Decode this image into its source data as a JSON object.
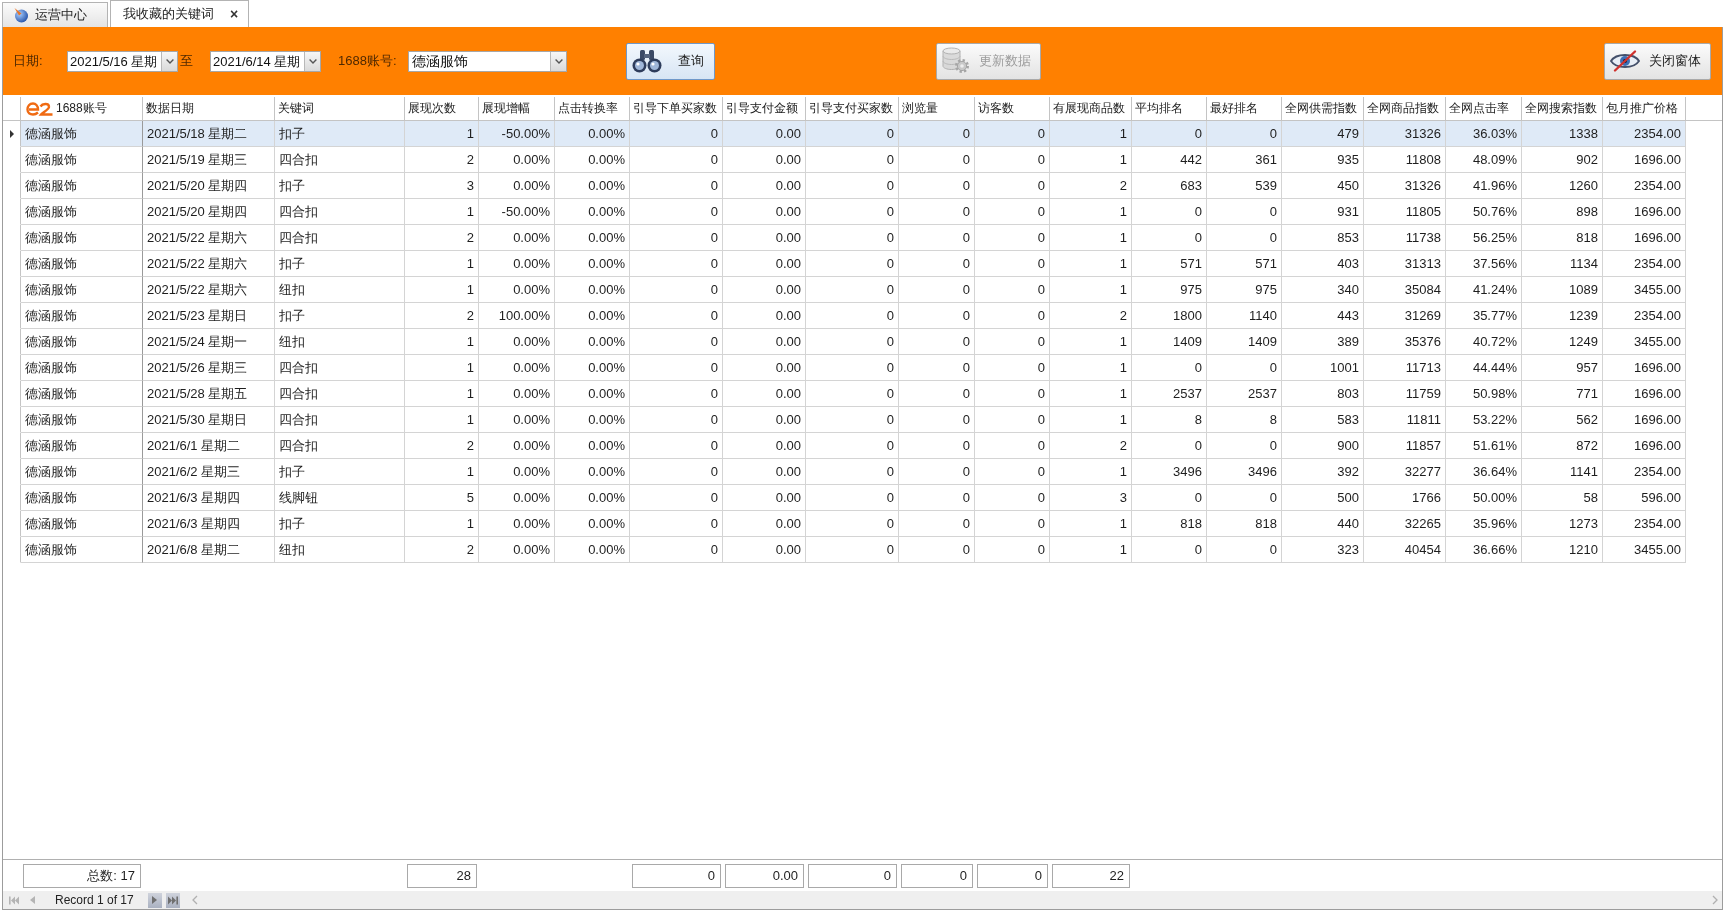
{
  "tabs": [
    {
      "label": "运营中心",
      "selected": false
    },
    {
      "label": "我收藏的关键词",
      "selected": true,
      "close": "×"
    }
  ],
  "toolbar": {
    "date_label": "日期:",
    "date_from": {
      "value": "2021/5/16 星期"
    },
    "date_separator": "至",
    "date_to": {
      "value": "2021/6/14 星期"
    },
    "account_label": "1688账号:",
    "account": {
      "value": "德涵服饰"
    },
    "buttons": [
      {
        "kind": "query",
        "label": "查询",
        "disabled": false,
        "focused": true
      },
      {
        "kind": "update",
        "label": "更新数据",
        "disabled": true,
        "focused": false
      },
      {
        "kind": "close",
        "label": "关闭窗体",
        "disabled": false,
        "focused": false
      }
    ]
  },
  "table": {
    "columns": [
      {
        "label": "1688账号",
        "kind": "text",
        "total": "总数: 17"
      },
      {
        "label": "数据日期",
        "kind": "text"
      },
      {
        "label": "关键词",
        "kind": "text"
      },
      {
        "label": "展现次数",
        "kind": "number",
        "total": "28"
      },
      {
        "label": "展现增幅",
        "kind": "number"
      },
      {
        "label": "点击转换率",
        "kind": "number"
      },
      {
        "label": "引导下单买家数",
        "kind": "number",
        "total": "0"
      },
      {
        "label": "引导支付金额",
        "kind": "number",
        "total": "0.00"
      },
      {
        "label": "引导支付买家数",
        "kind": "number",
        "total": "0"
      },
      {
        "label": "浏览量",
        "kind": "number",
        "total": "0"
      },
      {
        "label": "访客数",
        "kind": "number",
        "total": "0"
      },
      {
        "label": "有展现商品数",
        "kind": "number",
        "total": "22"
      },
      {
        "label": "平均排名",
        "kind": "number"
      },
      {
        "label": "最好排名",
        "kind": "number"
      },
      {
        "label": "全网供需指数",
        "kind": "number"
      },
      {
        "label": "全网商品指数",
        "kind": "number"
      },
      {
        "label": "全网点击率",
        "kind": "number"
      },
      {
        "label": "全网搜索指数",
        "kind": "number"
      },
      {
        "label": "包月推广价格",
        "kind": "number"
      }
    ],
    "rows": [
      {
        "selected": true,
        "cells": [
          "德涵服饰",
          "2021/5/18 星期二",
          "扣子",
          "1",
          "-50.00%",
          "0.00%",
          "0",
          "0.00",
          "0",
          "0",
          "0",
          "1",
          "0",
          "0",
          "479",
          "31326",
          "36.03%",
          "1338",
          "2354.00"
        ]
      },
      {
        "selected": false,
        "cells": [
          "德涵服饰",
          "2021/5/19 星期三",
          "四合扣",
          "2",
          "0.00%",
          "0.00%",
          "0",
          "0.00",
          "0",
          "0",
          "0",
          "1",
          "442",
          "361",
          "935",
          "11808",
          "48.09%",
          "902",
          "1696.00"
        ]
      },
      {
        "selected": false,
        "cells": [
          "德涵服饰",
          "2021/5/20 星期四",
          "扣子",
          "3",
          "0.00%",
          "0.00%",
          "0",
          "0.00",
          "0",
          "0",
          "0",
          "2",
          "683",
          "539",
          "450",
          "31326",
          "41.96%",
          "1260",
          "2354.00"
        ]
      },
      {
        "selected": false,
        "cells": [
          "德涵服饰",
          "2021/5/20 星期四",
          "四合扣",
          "1",
          "-50.00%",
          "0.00%",
          "0",
          "0.00",
          "0",
          "0",
          "0",
          "1",
          "0",
          "0",
          "931",
          "11805",
          "50.76%",
          "898",
          "1696.00"
        ]
      },
      {
        "selected": false,
        "cells": [
          "德涵服饰",
          "2021/5/22 星期六",
          "四合扣",
          "2",
          "0.00%",
          "0.00%",
          "0",
          "0.00",
          "0",
          "0",
          "0",
          "1",
          "0",
          "0",
          "853",
          "11738",
          "56.25%",
          "818",
          "1696.00"
        ]
      },
      {
        "selected": false,
        "cells": [
          "德涵服饰",
          "2021/5/22 星期六",
          "扣子",
          "1",
          "0.00%",
          "0.00%",
          "0",
          "0.00",
          "0",
          "0",
          "0",
          "1",
          "571",
          "571",
          "403",
          "31313",
          "37.56%",
          "1134",
          "2354.00"
        ]
      },
      {
        "selected": false,
        "cells": [
          "德涵服饰",
          "2021/5/22 星期六",
          "纽扣",
          "1",
          "0.00%",
          "0.00%",
          "0",
          "0.00",
          "0",
          "0",
          "0",
          "1",
          "975",
          "975",
          "340",
          "35084",
          "41.24%",
          "1089",
          "3455.00"
        ]
      },
      {
        "selected": false,
        "cells": [
          "德涵服饰",
          "2021/5/23 星期日",
          "扣子",
          "2",
          "100.00%",
          "0.00%",
          "0",
          "0.00",
          "0",
          "0",
          "0",
          "2",
          "1800",
          "1140",
          "443",
          "31269",
          "35.77%",
          "1239",
          "2354.00"
        ]
      },
      {
        "selected": false,
        "cells": [
          "德涵服饰",
          "2021/5/24 星期一",
          "纽扣",
          "1",
          "0.00%",
          "0.00%",
          "0",
          "0.00",
          "0",
          "0",
          "0",
          "1",
          "1409",
          "1409",
          "389",
          "35376",
          "40.72%",
          "1249",
          "3455.00"
        ]
      },
      {
        "selected": false,
        "cells": [
          "德涵服饰",
          "2021/5/26 星期三",
          "四合扣",
          "1",
          "0.00%",
          "0.00%",
          "0",
          "0.00",
          "0",
          "0",
          "0",
          "1",
          "0",
          "0",
          "1001",
          "11713",
          "44.44%",
          "957",
          "1696.00"
        ]
      },
      {
        "selected": false,
        "cells": [
          "德涵服饰",
          "2021/5/28 星期五",
          "四合扣",
          "1",
          "0.00%",
          "0.00%",
          "0",
          "0.00",
          "0",
          "0",
          "0",
          "1",
          "2537",
          "2537",
          "803",
          "11759",
          "50.98%",
          "771",
          "1696.00"
        ]
      },
      {
        "selected": false,
        "cells": [
          "德涵服饰",
          "2021/5/30 星期日",
          "四合扣",
          "1",
          "0.00%",
          "0.00%",
          "0",
          "0.00",
          "0",
          "0",
          "0",
          "1",
          "8",
          "8",
          "583",
          "11811",
          "53.22%",
          "562",
          "1696.00"
        ]
      },
      {
        "selected": false,
        "cells": [
          "德涵服饰",
          "2021/6/1 星期二",
          "四合扣",
          "2",
          "0.00%",
          "0.00%",
          "0",
          "0.00",
          "0",
          "0",
          "0",
          "2",
          "0",
          "0",
          "900",
          "11857",
          "51.61%",
          "872",
          "1696.00"
        ]
      },
      {
        "selected": false,
        "cells": [
          "德涵服饰",
          "2021/6/2 星期三",
          "扣子",
          "1",
          "0.00%",
          "0.00%",
          "0",
          "0.00",
          "0",
          "0",
          "0",
          "1",
          "3496",
          "3496",
          "392",
          "32277",
          "36.64%",
          "1141",
          "2354.00"
        ]
      },
      {
        "selected": false,
        "cells": [
          "德涵服饰",
          "2021/6/3 星期四",
          "线脚钮",
          "5",
          "0.00%",
          "0.00%",
          "0",
          "0.00",
          "0",
          "0",
          "0",
          "3",
          "0",
          "0",
          "500",
          "1766",
          "50.00%",
          "58",
          "596.00"
        ]
      },
      {
        "selected": false,
        "cells": [
          "德涵服饰",
          "2021/6/3 星期四",
          "扣子",
          "1",
          "0.00%",
          "0.00%",
          "0",
          "0.00",
          "0",
          "0",
          "0",
          "1",
          "818",
          "818",
          "440",
          "32265",
          "35.96%",
          "1273",
          "2354.00"
        ]
      },
      {
        "selected": false,
        "cells": [
          "德涵服饰",
          "2021/6/8 星期二",
          "纽扣",
          "2",
          "0.00%",
          "0.00%",
          "0",
          "0.00",
          "0",
          "0",
          "0",
          "1",
          "0",
          "0",
          "323",
          "40454",
          "36.66%",
          "1210",
          "3455.00"
        ]
      }
    ]
  },
  "navigator": {
    "items": [
      {
        "kind": "first",
        "disabled": true
      },
      {
        "kind": "prev",
        "disabled": true
      },
      {
        "kind": "text",
        "text": "Record 1 of 17"
      },
      {
        "kind": "next",
        "disabled": false
      },
      {
        "kind": "last",
        "disabled": false
      }
    ]
  }
}
